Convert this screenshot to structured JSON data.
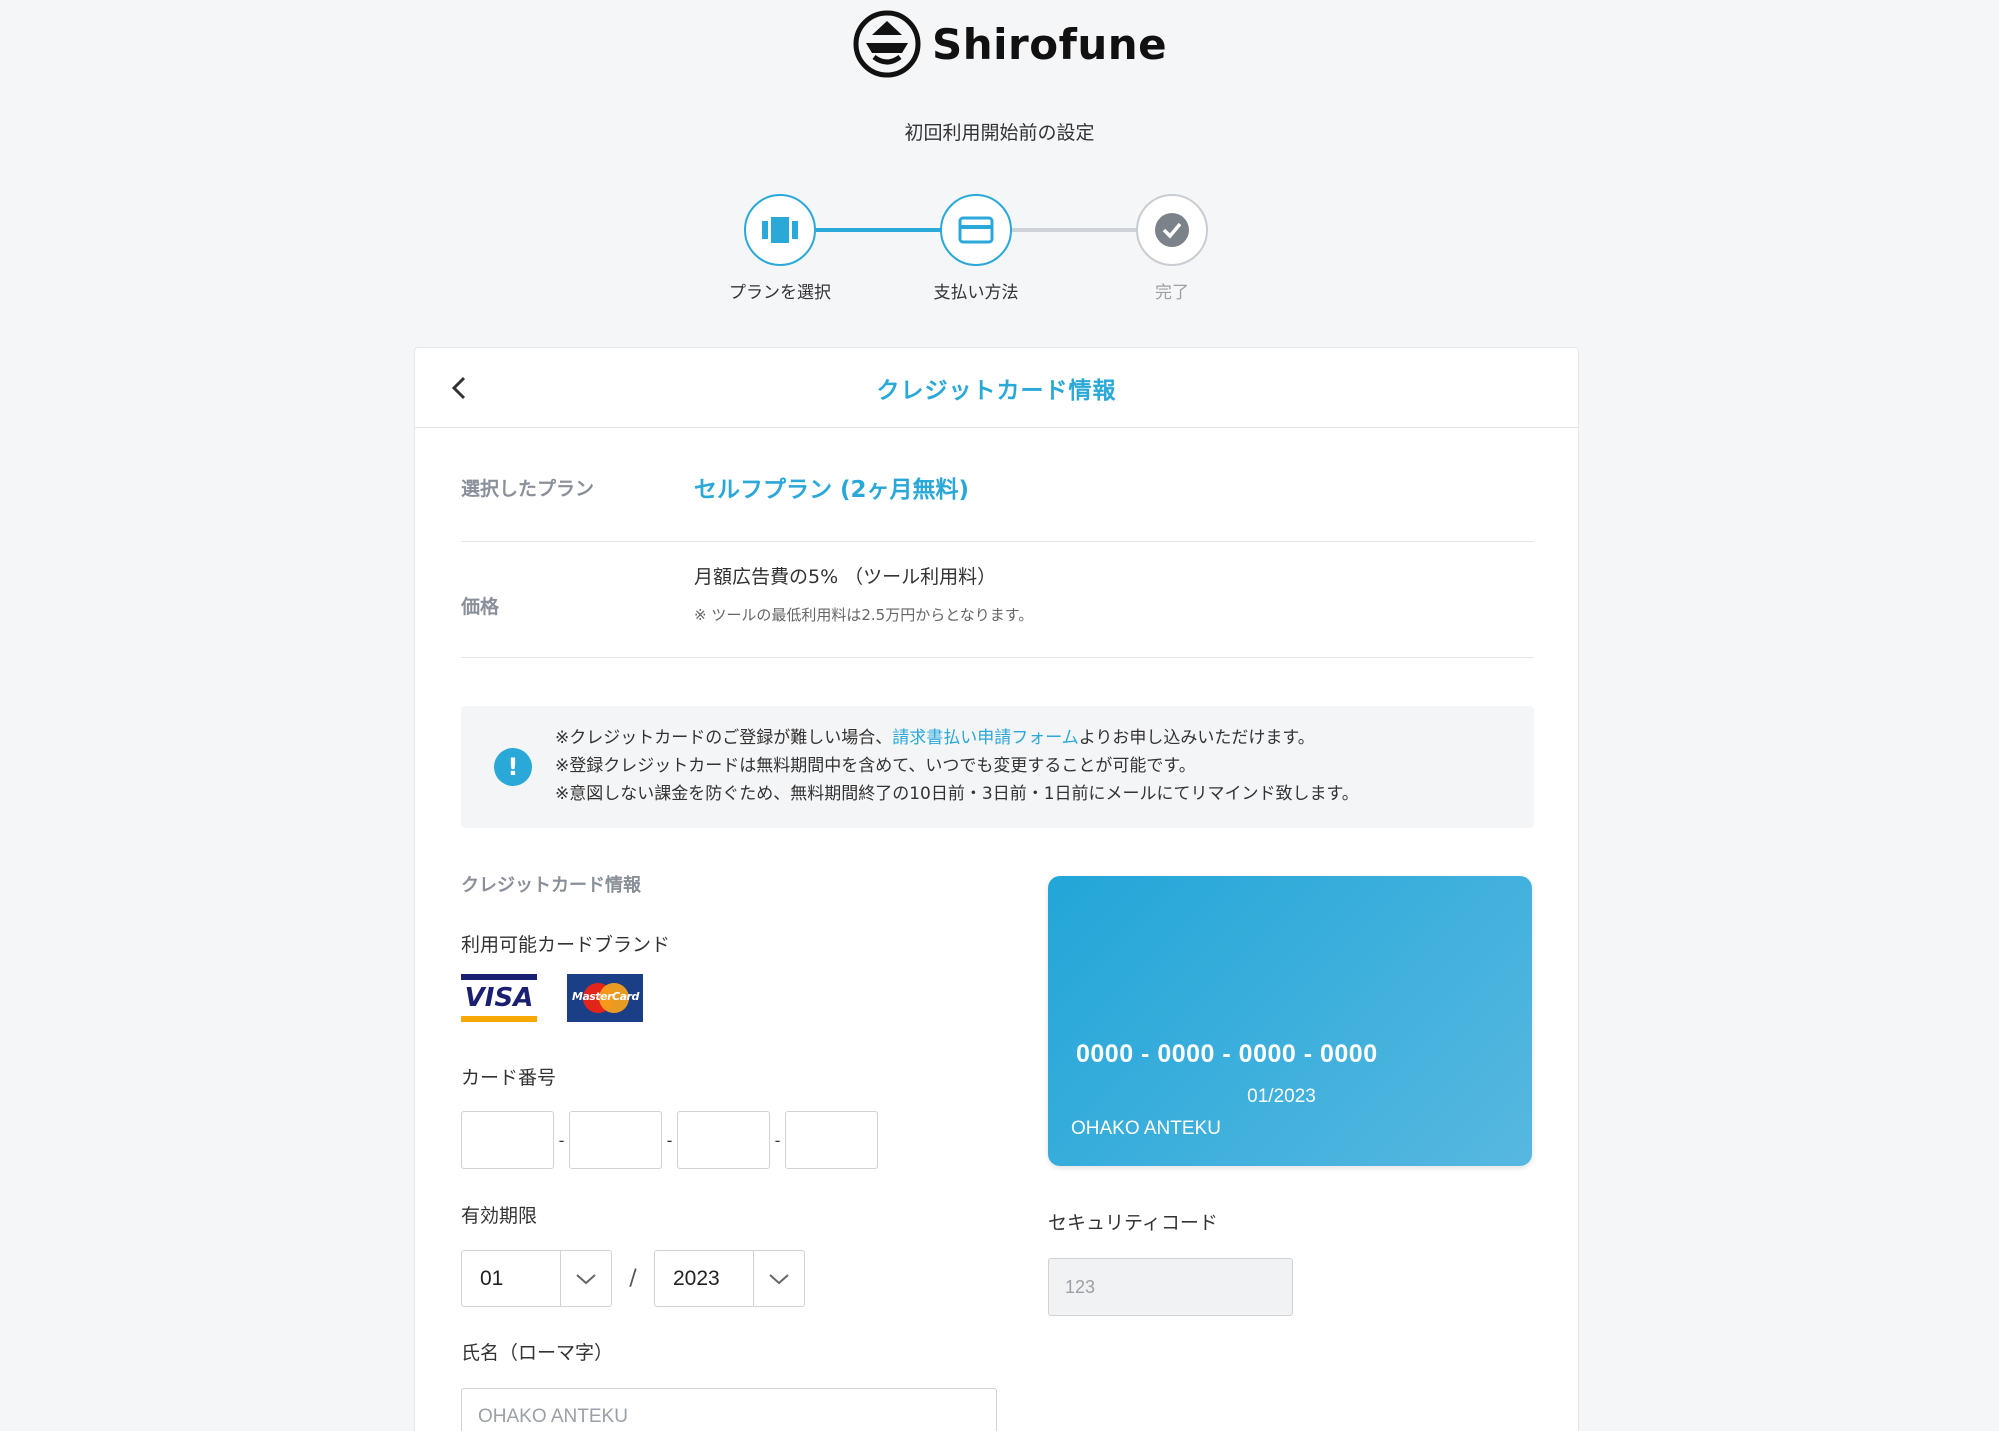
{
  "brand": {
    "name": "Shirofune"
  },
  "setup_title": "初回利用開始前の設定",
  "steps": [
    {
      "label": "プランを選択",
      "icon": "plan-icon",
      "state": "done"
    },
    {
      "label": "支払い方法",
      "icon": "credit-card-icon",
      "state": "current"
    },
    {
      "label": "完了",
      "icon": "check-icon",
      "state": "todo"
    }
  ],
  "panel": {
    "title": "クレジットカード情報",
    "plan_label": "選択したプラン",
    "plan_value": "セルフプラン (2ヶ月無料)",
    "price_label": "価格",
    "price_value": "月額広告費の5% （ツール利用料）",
    "price_note": "※ ツールの最低利用料は2.5万円からとなります。"
  },
  "notice": {
    "line1_prefix": "※クレジットカードのご登録が難しい場合、",
    "line1_link": "請求書払い申請フォーム",
    "line1_suffix": "よりお申し込みいただけます。",
    "line2": "※登録クレジットカードは無料期間中を含めて、いつでも変更することが可能です。",
    "line3": "※意図しない課金を防ぐため、無料期間終了の10日前・3日前・1日前にメールにてリマインド致します。"
  },
  "form": {
    "section_label": "クレジットカード情報",
    "brands_label": "利用可能カードブランド",
    "brands": [
      {
        "name": "VISA",
        "icon": "visa-icon"
      },
      {
        "name": "MasterCard",
        "icon": "mastercard-icon"
      }
    ],
    "card_number_label": "カード番号",
    "card_number_separator": "-",
    "card_number_values": [
      "",
      "",
      "",
      ""
    ],
    "expiry_label": "有効期限",
    "expiry_month": "01",
    "expiry_separator": "/",
    "expiry_year": "2023",
    "name_label": "氏名（ローマ字）",
    "name_placeholder": "OHAKO ANTEKU",
    "security_label": "セキュリティコード",
    "security_placeholder": "123"
  },
  "card_preview": {
    "number": "0000 - 0000 - 0000 - 0000",
    "expiry": "01/2023",
    "holder": "OHAKO ANTEKU"
  },
  "colors": {
    "accent": "#2aa8d8",
    "background": "#f5f6f8",
    "muted": "#8a9099"
  }
}
